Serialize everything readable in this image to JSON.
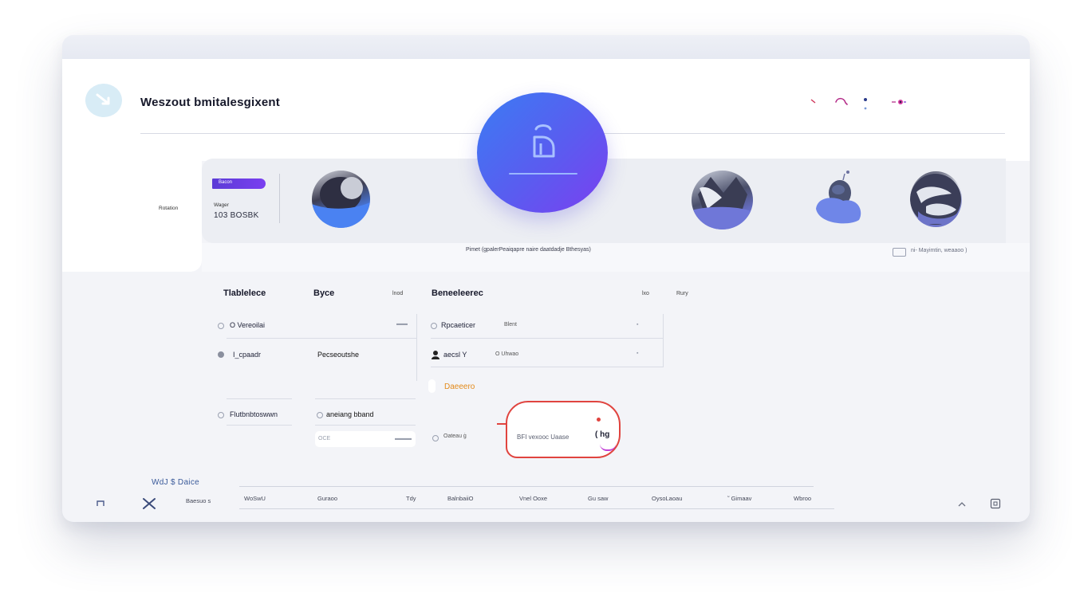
{
  "header": {
    "title": "Weszout bmitalesgixent",
    "icons": [
      "arrow-icon",
      "loop-icon",
      "dot-icon",
      "link-icon"
    ],
    "hero_icon": "bag-icon"
  },
  "profile_cards": {
    "side_label": "Rotation",
    "pill_label": "Bacon",
    "stat_label": "Wager",
    "stat_value": "103 BOSBK",
    "caption": "Pimet (gpalerPeaiqapre naire daatdadje Bthesyas)",
    "caption_right": "ni- Mayimtin, weaaoo )"
  },
  "table": {
    "headers": {
      "col1": "Tlablelece",
      "col2": "Byce",
      "col2_tag": "lnod",
      "col3": "Beneeleerec",
      "col3_tag": "lxo",
      "col4": "Rury"
    },
    "left_rows": [
      {
        "label": "O Vereoilai",
        "trailing": "▬▬"
      },
      {
        "label": "I_cpaadr",
        "middle": "Pecseoutshe"
      }
    ],
    "right_rows": [
      {
        "label": "Rpcaeticer",
        "middle": "Blent",
        "trailing": "▪"
      },
      {
        "label": "aecsl Y",
        "middle": "O Uhwao",
        "trailing": "▪"
      }
    ],
    "orange_label": "Daeeero",
    "row3_left": "Flutbnbtoswwn",
    "row3_mid": "aneiang bband",
    "row3_field_left": "OCE",
    "row3_field_right": "▬▬▬",
    "row3_right": "Oateau ġ",
    "tooltip_text": "BFI vexooc Uaase",
    "tooltip_tag": "( hg"
  },
  "footer": {
    "title": "WdJ $ Daice",
    "left_label": "Baesuo s",
    "columns": [
      "WoSwU",
      "Guraoo",
      "Tdy",
      "BalnbaiiO",
      "Vnel Ooxe",
      "Gu saw",
      "OysoLaoau",
      "˜ Gimaav",
      "Wbroo"
    ]
  },
  "colors": {
    "accent_start": "#3b7cf3",
    "accent_end": "#7b3ff0",
    "tooltip_border": "#e0443f",
    "warning": "#e38a1a"
  }
}
